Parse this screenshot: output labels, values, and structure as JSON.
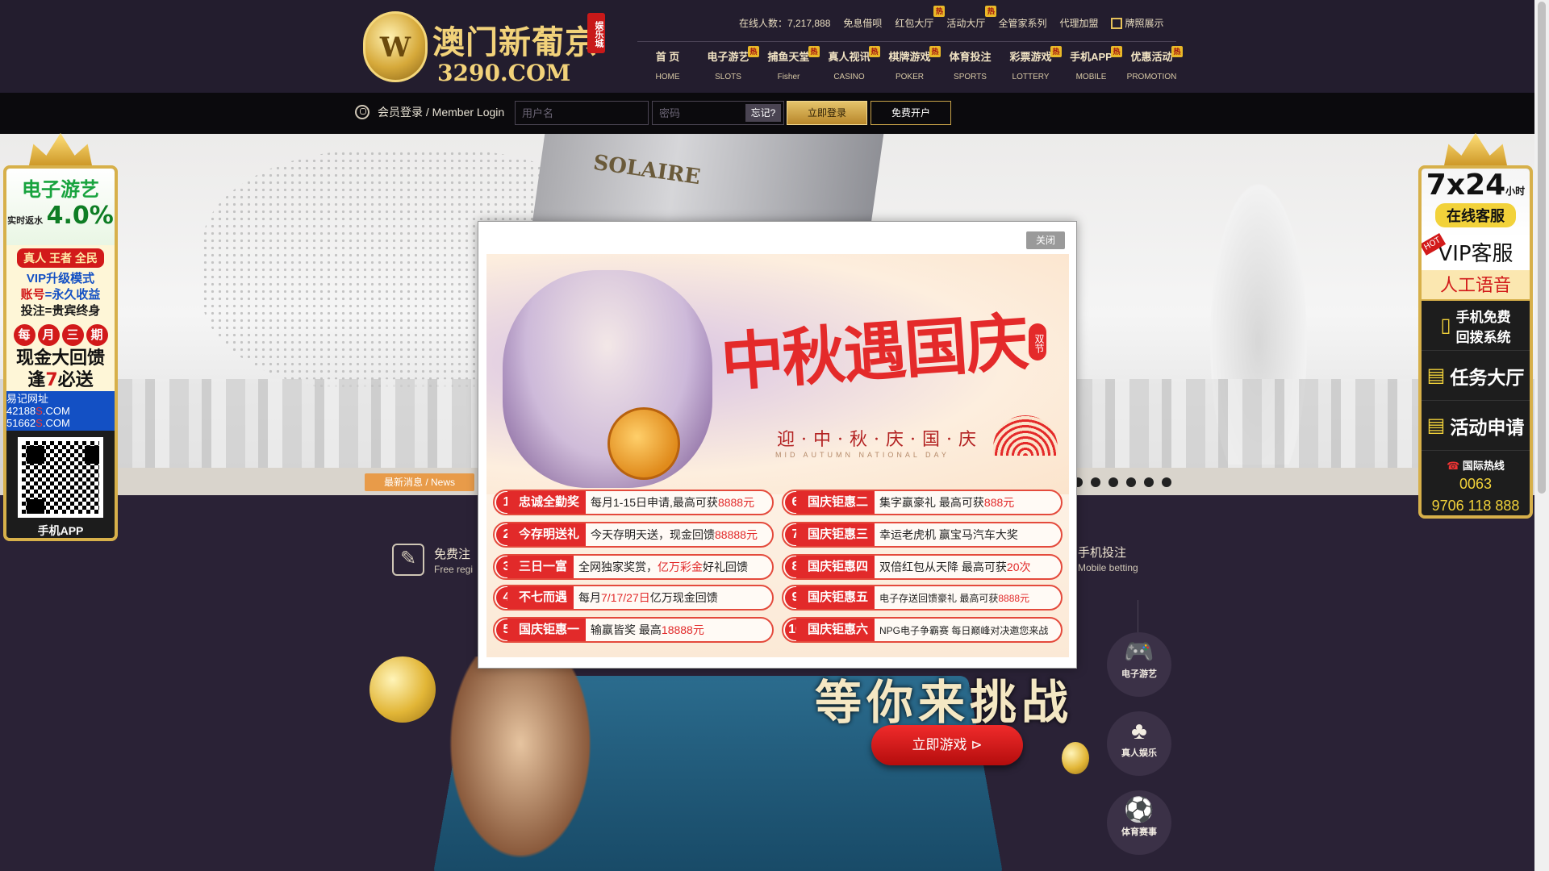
{
  "header": {
    "logo_title": "澳门新葡京",
    "logo_badge": "娱乐城",
    "logo_url": "3290.COM",
    "toplinks": [
      {
        "label": "在线人数：7,217,888",
        "hot": false
      },
      {
        "label": "免息借呗",
        "hot": false
      },
      {
        "label": "红包大厅",
        "hot": true
      },
      {
        "label": "活动大厅",
        "hot": true
      },
      {
        "label": "全管家系列",
        "hot": false
      },
      {
        "label": "代理加盟",
        "hot": false
      },
      {
        "label": "牌照展示",
        "hot": false,
        "icon": "license-icon"
      }
    ],
    "hot_mark": "热",
    "nav": [
      {
        "zh": "首 页",
        "en": "HOME",
        "hot": false
      },
      {
        "zh": "电子游艺",
        "en": "SLOTS",
        "hot": true
      },
      {
        "zh": "捕鱼天堂",
        "en": "Fisher",
        "hot": true
      },
      {
        "zh": "真人视讯",
        "en": "CASINO",
        "hot": true
      },
      {
        "zh": "棋牌游戏",
        "en": "POKER",
        "hot": true
      },
      {
        "zh": "体育投注",
        "en": "SPORTS",
        "hot": false
      },
      {
        "zh": "彩票游戏",
        "en": "LOTTERY",
        "hot": true
      },
      {
        "zh": "手机APP",
        "en": "MOBILE",
        "hot": true
      },
      {
        "zh": "优惠活动",
        "en": "PROMOTION",
        "hot": true
      }
    ]
  },
  "login": {
    "label": "会员登录 / Member Login",
    "username_placeholder": "用户名",
    "password_placeholder": "密码",
    "forgot": "忘记?",
    "login_button": "立即登录",
    "register_button": "免费开户"
  },
  "banner": {
    "building_sign": "SOLAIRE",
    "news_tag": "最新消息 / News",
    "slide_count": 6
  },
  "features": [
    {
      "title": "免费注",
      "sub": "Free regi"
    },
    {
      "title": "手机投注",
      "sub": "Mobile betting"
    }
  ],
  "game": {
    "headline": "等你来挑战",
    "play_button": "立即游戏",
    "play_icon": "play-circle-icon",
    "categories": [
      {
        "label": "电子游艺",
        "icon": "gamepad-icon"
      },
      {
        "label": "真人娱乐",
        "icon": "cards-icon"
      },
      {
        "label": "体育赛事",
        "icon": "soccer-ball-icon"
      }
    ]
  },
  "float_left": {
    "slot_title": "电子游艺",
    "rebate_label": "实时返水",
    "rebate_value": "4.0%",
    "vip_tag": "真人 王者 全民",
    "vip_line1": "VIP升级模式",
    "vip_line2_a": "账号",
    "vip_line2_b": "=永久收益",
    "vip_line3": "投注=贵宾终身",
    "period": [
      "每",
      "月",
      "三",
      "期"
    ],
    "cash_line1": "现金大回馈",
    "cash_line2_a": "逢",
    "cash_line2_b": "7",
    "cash_line2_c": "必送",
    "site_label": "易记网址",
    "site1_a": "42188",
    "site1_b": "S",
    "site1_c": ".COM",
    "site2_a": "51662",
    "site2_b": "S",
    "site2_c": ".COM",
    "app_label": "手机APP"
  },
  "float_right": {
    "service_hours": "7x24",
    "service_unit": "小时",
    "service_label": "在线客服",
    "vip_label": "VIP客服",
    "hot_badge": "HOT",
    "voice_label": "人工语音",
    "callback_line1": "手机免费",
    "callback_line2": "回拨系统",
    "task_label": "任务大厅",
    "apply_label": "活动申请",
    "hotline_label": "国际热线",
    "hotline_1": "0063",
    "hotline_2": "9706 118 888"
  },
  "modal": {
    "close_label": "关闭",
    "title": "中秋遇国庆",
    "tag": "双节",
    "subtitle": "迎·中·秋·庆·国·庆",
    "subtitle_en": "MID AUTUMN NATIONAL DAY",
    "items": [
      {
        "num": "1",
        "name": "忠诚全勤奖",
        "desc_a": "每月1-15日申请,最高可获",
        "desc_b": "8888元"
      },
      {
        "num": "2",
        "name": "今存明送礼",
        "desc_a": "今天存明天送，现金回馈",
        "desc_b": "88888元"
      },
      {
        "num": "3",
        "name": "三日一富",
        "desc_a": "全网独家奖赏，",
        "desc_b": "亿万彩金",
        "desc_c": "好礼回馈"
      },
      {
        "num": "4",
        "name": "不七而遇",
        "desc_a": "每月",
        "desc_b": "7/17/27日",
        "desc_c": "亿万现金回馈"
      },
      {
        "num": "5",
        "name": "国庆钜惠一",
        "desc_a": "输赢皆奖 最高",
        "desc_b": "18888元"
      },
      {
        "num": "6",
        "name": "国庆钜惠二",
        "desc_a": "集字赢豪礼 最高可获",
        "desc_b": "888元"
      },
      {
        "num": "7",
        "name": "国庆钜惠三",
        "desc_a": "幸运老虎机 赢宝马汽车大奖"
      },
      {
        "num": "8",
        "name": "国庆钜惠四",
        "desc_a": "双倍红包从天降 最高可获",
        "desc_b": "20次"
      },
      {
        "num": "9",
        "name": "国庆钜惠五",
        "desc_a": "电子存送回馈豪礼 最高可获",
        "desc_b": "8888元"
      },
      {
        "num": "10",
        "name": "国庆钜惠六",
        "desc_a": "NPG电子争霸赛 每日巅峰对决邀您来战"
      }
    ]
  }
}
